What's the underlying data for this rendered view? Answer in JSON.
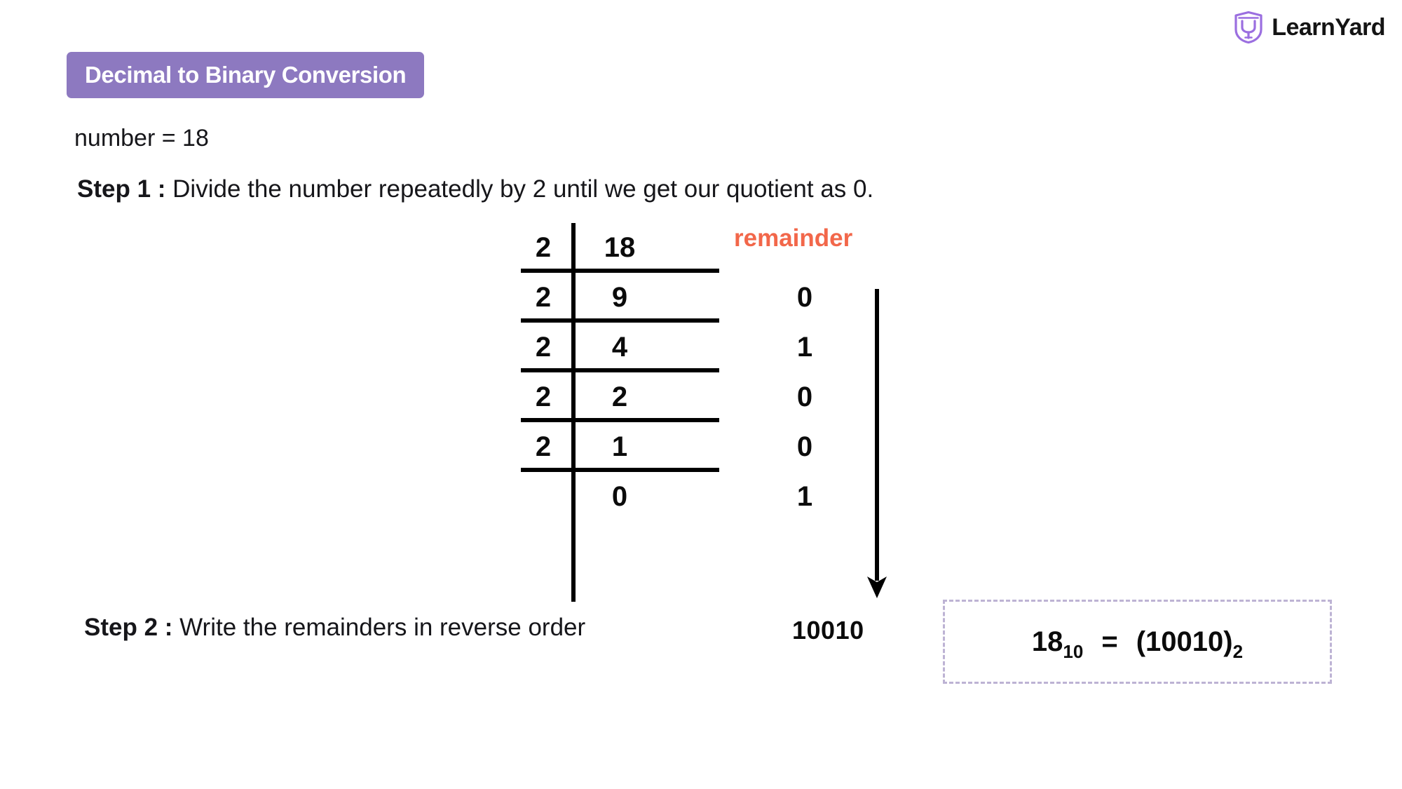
{
  "brand": {
    "name": "LearnYard",
    "logo_icon": "shield-y-logo-icon",
    "logo_color": "#9b6fe0"
  },
  "title": {
    "text": "Decimal to Binary Conversion",
    "background_color": "#8d79c0",
    "text_color": "#ffffff"
  },
  "intro": {
    "text": "number = 18"
  },
  "steps": [
    {
      "label": "Step 1 :",
      "body": " Divide the number repeatedly by 2  until we get our quotient as 0."
    },
    {
      "label": "Step 2 :",
      "body": " Write the remainders in reverse order"
    }
  ],
  "division": {
    "divisor": "2",
    "remainder_header": "remainder",
    "remainder_header_color": "#f2674a",
    "arrow_icon": "arrow-down-icon",
    "rows": [
      {
        "divisor": "2",
        "quotient": "18",
        "remainder": ""
      },
      {
        "divisor": "2",
        "quotient": "9",
        "remainder": "0"
      },
      {
        "divisor": "2",
        "quotient": "4",
        "remainder": "1"
      },
      {
        "divisor": "2",
        "quotient": "2",
        "remainder": "0"
      },
      {
        "divisor": "2",
        "quotient": "1",
        "remainder": "0"
      },
      {
        "divisor": "",
        "quotient": "0",
        "remainder": "1"
      }
    ]
  },
  "reverse_result": "10010",
  "conclusion": {
    "decimal_value": "18",
    "decimal_base": "10",
    "equals": "=",
    "binary_open": "(",
    "binary_value": "10010",
    "binary_close": ")",
    "binary_base": "2",
    "border_color": "#bdb3d4"
  }
}
